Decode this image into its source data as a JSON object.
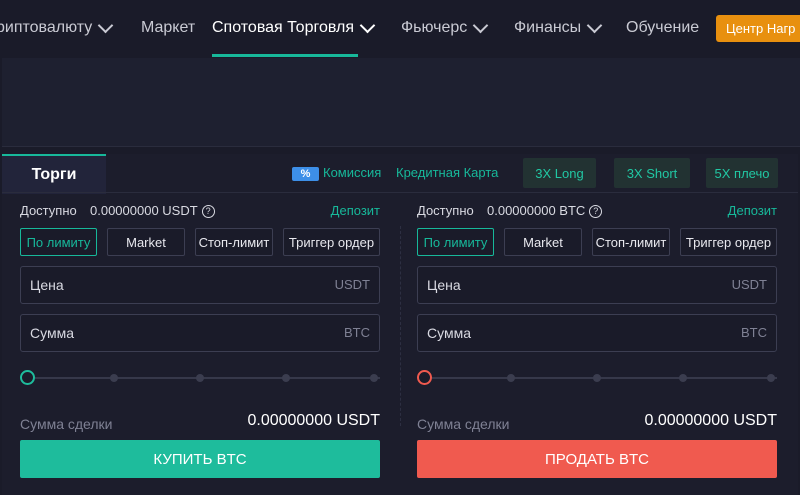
{
  "nav": {
    "items": [
      {
        "label": "риптовалюту",
        "has_dropdown": true
      },
      {
        "label": "Маркет",
        "has_dropdown": false
      },
      {
        "label": "Спотовая Торговля",
        "has_dropdown": true,
        "active": true
      },
      {
        "label": "Фьючерс",
        "has_dropdown": true
      },
      {
        "label": "Финансы",
        "has_dropdown": true
      },
      {
        "label": "Обучение",
        "has_dropdown": false
      }
    ],
    "reward_button": "Центр Нагр"
  },
  "trade": {
    "tab_label": "Торги",
    "fee_badge": "%",
    "fee_label": "Комиссия",
    "credit_label": "Кредитная Карта",
    "leverage": [
      "3X Long",
      "3X Short",
      "5X плечо"
    ]
  },
  "buy": {
    "available_label": "Доступно",
    "available_value": "0.00000000 USDT",
    "deposit": "Депозит",
    "order_types": [
      "По лимиту",
      "Market",
      "Стоп-лимит",
      "Триггер ордер"
    ],
    "selected_order_type": "По лимиту",
    "price_label": "Цена",
    "price_unit": "USDT",
    "amount_label": "Сумма",
    "amount_unit": "BTC",
    "slider_percent": 0,
    "total_label": "Сумма сделки",
    "total_value": "0.00000000 USDT",
    "button": "КУПИТЬ BTC"
  },
  "sell": {
    "available_label": "Доступно",
    "available_value": "0.00000000 BTC",
    "deposit": "Депозит",
    "order_types": [
      "По лимиту",
      "Market",
      "Стоп-лимит",
      "Триггер ордер"
    ],
    "selected_order_type": "По лимиту",
    "price_label": "Цена",
    "price_unit": "USDT",
    "amount_label": "Сумма",
    "amount_unit": "BTC",
    "slider_percent": 0,
    "total_label": "Сумма сделки",
    "total_value": "0.00000000 USDT",
    "button": "ПРОДАТЬ BTC"
  },
  "colors": {
    "accent": "#17b89a",
    "buy": "#1ebc9c",
    "sell": "#f05a4f",
    "reward": "#e8900f",
    "background": "#1a1b29"
  },
  "icons": {
    "dropdown": "chevron-down-icon",
    "help": "question-circle-icon"
  }
}
